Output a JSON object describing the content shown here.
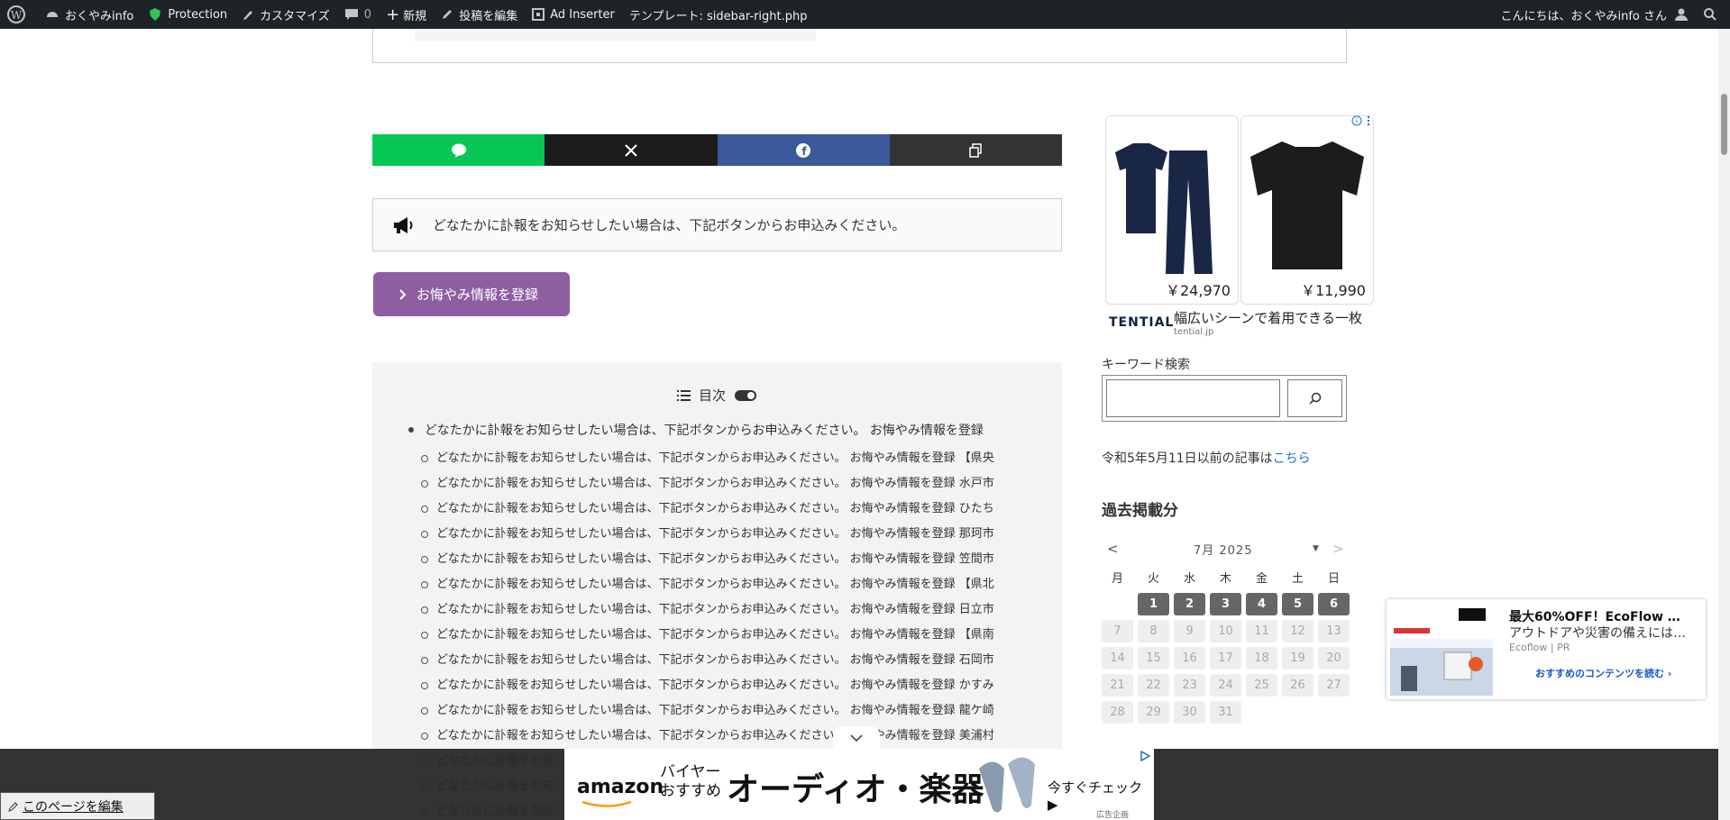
{
  "adminbar": {
    "site_name": "おくやみinfo",
    "protection": "Protection",
    "customize": "カスタマイズ",
    "comments_count": "0",
    "new": "新規",
    "edit_post": "投稿を編集",
    "ad_inserter": "Ad Inserter",
    "template": "テンプレート: sidebar-right.php",
    "greeting": "こんにちは、おくやみinfo さん"
  },
  "notice": {
    "text": "どなたかに訃報をお知らせしたい場合は、下記ボタンからお申込みください。"
  },
  "register_button": "お悔やみ情報を登録",
  "toc": {
    "title": "目次",
    "top_item": "どなたかに訃報をお知らせしたい場合は、下記ボタンからお申込みください。 お悔やみ情報を登録",
    "items": [
      "どなたかに訃報をお知らせしたい場合は、下記ボタンからお申込みください。 お悔やみ情報を登録 【県央",
      "どなたかに訃報をお知らせしたい場合は、下記ボタンからお申込みください。 お悔やみ情報を登録 水戸市",
      "どなたかに訃報をお知らせしたい場合は、下記ボタンからお申込みください。 お悔やみ情報を登録 ひたち",
      "どなたかに訃報をお知らせしたい場合は、下記ボタンからお申込みください。 お悔やみ情報を登録 那珂市",
      "どなたかに訃報をお知らせしたい場合は、下記ボタンからお申込みください。 お悔やみ情報を登録 笠間市",
      "どなたかに訃報をお知らせしたい場合は、下記ボタンからお申込みください。 お悔やみ情報を登録 【県北",
      "どなたかに訃報をお知らせしたい場合は、下記ボタンからお申込みください。 お悔やみ情報を登録 日立市",
      "どなたかに訃報をお知らせしたい場合は、下記ボタンからお申込みください。 お悔やみ情報を登録 【県南",
      "どなたかに訃報をお知らせしたい場合は、下記ボタンからお申込みください。 お悔やみ情報を登録 石岡市",
      "どなたかに訃報をお知らせしたい場合は、下記ボタンからお申込みください。 お悔やみ情報を登録 かすみ",
      "どなたかに訃報をお知らせしたい場合は、下記ボタンからお申込みください。 お悔やみ情報を登録 龍ケ崎",
      "どなたかに訃報をお知らせしたい場合は、下記ボタンからお申込みください。 お悔やみ情報を登録 美浦村",
      "どなたかに訃報をお知",
      "どなたかに訃報をお知",
      "どなたかに訃報をお知"
    ]
  },
  "side_ad": {
    "price1": "￥24,970",
    "price2": "￥11,990",
    "brand": "TENTIAL",
    "text": "幅広いシーンで着用できる一枚",
    "url": "tential.jp"
  },
  "search": {
    "label": "キーワード検索",
    "value": ""
  },
  "old_posts": {
    "prefix": "令和5年5月11日以前の記事は",
    "link": "こちら"
  },
  "past": {
    "heading": "過去掲載分"
  },
  "calendar": {
    "prev": "<",
    "month": "7月 2025",
    "dropdown": "▼",
    "next": ">",
    "weekdays": [
      "月",
      "火",
      "水",
      "木",
      "金",
      "土",
      "日"
    ],
    "active_days": [
      "1",
      "2",
      "3",
      "4",
      "5",
      "6"
    ],
    "inactive_days": [
      "7",
      "8",
      "9",
      "10",
      "11",
      "12",
      "13",
      "14",
      "15",
      "16",
      "17",
      "18",
      "19",
      "20",
      "21",
      "22",
      "23",
      "24",
      "25",
      "26",
      "27",
      "28",
      "29",
      "30",
      "31"
    ]
  },
  "right_ad": {
    "title": "最大60%OFF！EcoFlow …",
    "subtitle": "アウトドアや災害の備えには…",
    "brand": "Ecoflow | PR",
    "cta": "おすすめのコンテンツを読む ›"
  },
  "amazon_ad": {
    "logo": "amazon",
    "buyer_line1": "バイヤー",
    "buyer_line2": "おすすめ",
    "title": "オーディオ・楽器",
    "cta": "今すぐチェック ▶",
    "small": "広告企画"
  },
  "edit_page": "このページを編集",
  "colors": {
    "adminbar": "#1d2327",
    "line": "#06c755",
    "x": "#1c1c1c",
    "facebook": "#3b5998",
    "copy": "#333333",
    "register": "#8e5ea2",
    "calendar_active": "#666666"
  }
}
